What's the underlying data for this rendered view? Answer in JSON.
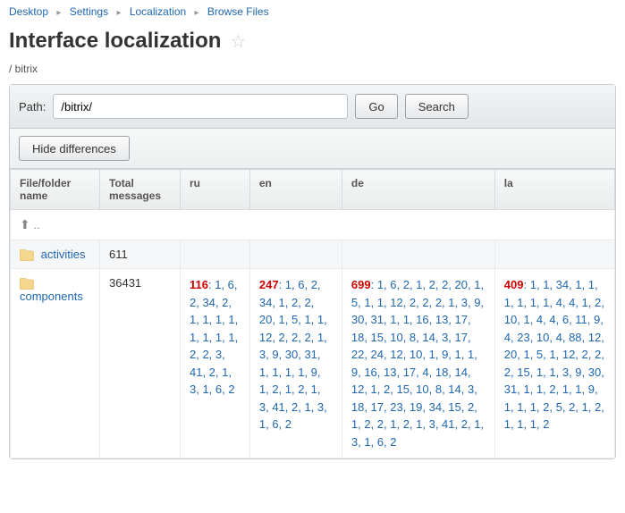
{
  "breadcrumb": [
    {
      "label": "Desktop"
    },
    {
      "label": "Settings"
    },
    {
      "label": "Localization"
    },
    {
      "label": "Browse Files"
    }
  ],
  "page_title": "Interface localization",
  "current_path_display": "/ bitrix",
  "toolbar": {
    "path_label": "Path:",
    "path_value": "/bitrix/",
    "go_label": "Go",
    "search_label": "Search"
  },
  "subbar": {
    "hide_diff_label": "Hide differences"
  },
  "columns": {
    "name": "File/folder name",
    "total": "Total messages",
    "ru": "ru",
    "en": "en",
    "de": "de",
    "la": "la"
  },
  "up_row": {
    "dots": ".."
  },
  "rows": [
    {
      "name": "activities",
      "total": "611",
      "ru": {
        "count": "",
        "nums": ""
      },
      "en": {
        "count": "",
        "nums": ""
      },
      "de": {
        "count": "",
        "nums": ""
      },
      "la": {
        "count": "",
        "nums": ""
      }
    },
    {
      "name": "components",
      "total": "36431",
      "ru": {
        "count": "116",
        "nums": "1, 6, 2, 34, 2, 1, 1, 1, 1, 1, 1, 1, 1, 2, 2, 3, 41, 2, 1, 3, 1, 6, 2"
      },
      "en": {
        "count": "247",
        "nums": "1, 6, 2, 34, 1, 2, 2, 20, 1, 5, 1, 1, 12, 2, 2, 2, 1, 3, 9, 30, 31, 1, 1, 1, 1, 9, 1, 2, 1, 2, 1, 3, 41, 2, 1, 3, 1, 6, 2"
      },
      "de": {
        "count": "699",
        "nums": "1, 6, 2, 1, 2, 2, 20, 1, 5, 1, 1, 12, 2, 2, 2, 1, 3, 9, 30, 31, 1, 1, 16, 13, 17, 18, 15, 10, 8, 14, 3, 17, 22, 24, 12, 10, 1, 9, 1, 1, 9, 16, 13, 17, 4, 18, 14, 12, 1, 2, 15, 10, 8, 14, 3, 18, 17, 23, 19, 34, 15, 2, 1, 2, 2, 1, 2, 1, 3, 41, 2, 1, 3, 1, 6, 2"
      },
      "la": {
        "count": "409",
        "nums": "1, 1, 34, 1, 1, 1, 1, 1, 1, 4, 4, 1, 2, 10, 1, 4, 4, 6, 11, 9, 4, 23, 10, 4, 88, 12, 20, 1, 5, 1, 12, 2, 2, 2, 15, 1, 1, 3, 9, 30, 31, 1, 1, 2, 1, 1, 9, 1, 1, 1, 2, 5, 2, 1, 2, 1, 1, 1, 2"
      }
    }
  ]
}
